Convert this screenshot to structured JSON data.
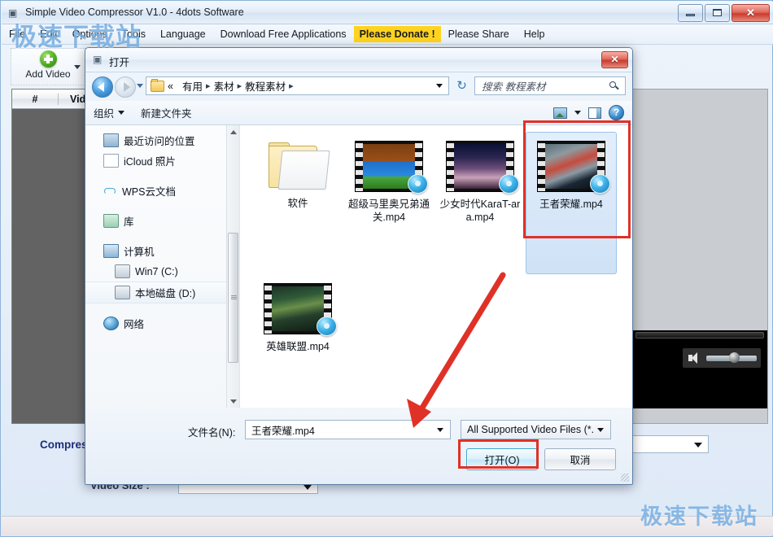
{
  "app": {
    "title": "Simple Video Compressor V1.0 - 4dots Software",
    "title_icon": "app-icon",
    "window_buttons": {
      "minimize": "",
      "maximize": "",
      "close": "✕"
    },
    "menu": [
      {
        "label": "File",
        "highlight": false
      },
      {
        "label": "Edit",
        "highlight": false
      },
      {
        "label": "Options",
        "highlight": false
      },
      {
        "label": "Tools",
        "highlight": false
      },
      {
        "label": "Language",
        "highlight": false
      },
      {
        "label": "Download Free Applications",
        "highlight": false
      },
      {
        "label": "Please Donate !",
        "highlight": true
      },
      {
        "label": "Please Share",
        "highlight": false
      },
      {
        "label": "Help",
        "highlight": false
      }
    ],
    "toolbar": {
      "add_video_label": "Add Video"
    },
    "table": {
      "columns": [
        "#",
        "Video"
      ]
    },
    "compress_label": "Compress",
    "video_size_label": "Video Size :"
  },
  "dialog": {
    "title": "打开",
    "title_icon": "folder-open-icon",
    "close_label": "✕",
    "breadcrumb": {
      "prefix": "«",
      "segments": [
        "有用",
        "素材",
        "教程素材"
      ],
      "separator": "▸"
    },
    "refresh_icon": "↻",
    "search": {
      "placeholder": "搜索 教程素材"
    },
    "toolbar": {
      "organize_label": "组织",
      "new_folder_label": "新建文件夹",
      "help_label": "?"
    },
    "nav_pane": [
      {
        "label": "最近访问的位置",
        "icon": "recent-places-icon",
        "type": "recent",
        "indent": false,
        "selected": false
      },
      {
        "label": "iCloud 照片",
        "icon": "document-icon",
        "type": "doc",
        "indent": false,
        "selected": false
      },
      {
        "label": "WPS云文档",
        "icon": "cloud-icon",
        "type": "cloud",
        "indent": false,
        "selected": false
      },
      {
        "label": "库",
        "icon": "library-icon",
        "type": "lib",
        "indent": false,
        "selected": false
      },
      {
        "label": "计算机",
        "icon": "computer-icon",
        "type": "pc",
        "indent": false,
        "selected": false
      },
      {
        "label": "Win7 (C:)",
        "icon": "hard-drive-icon",
        "type": "drive",
        "indent": true,
        "selected": false
      },
      {
        "label": "本地磁盘 (D:)",
        "icon": "hard-drive-icon",
        "type": "drive",
        "indent": true,
        "selected": true
      },
      {
        "label": "网络",
        "icon": "network-icon",
        "type": "net",
        "indent": false,
        "selected": false
      }
    ],
    "files": [
      {
        "name": "软件",
        "kind": "folder",
        "thumb": "",
        "selected": false
      },
      {
        "name": "超级马里奥兄弟通关.mp4",
        "kind": "video",
        "thumb": "img-mario",
        "selected": false
      },
      {
        "name": "少女时代KaraT-ara.mp4",
        "kind": "video",
        "thumb": "img-girls",
        "selected": false
      },
      {
        "name": "王者荣耀.mp4",
        "kind": "video",
        "thumb": "img-wz",
        "selected": true
      },
      {
        "name": "英雄联盟.mp4",
        "kind": "video",
        "thumb": "img-lol",
        "selected": false
      }
    ],
    "footer": {
      "filename_label": "文件名(N):",
      "filename_value": "王者荣耀.mp4",
      "filter_value": "All Supported Video Files (*.",
      "open_button": "打开(O)",
      "cancel_button": "取消"
    }
  },
  "watermark": {
    "text": "极速下载站"
  },
  "colors": {
    "donate_highlight": "#ffd320",
    "annotation_red": "#e03127",
    "accent_blue": "#1f2d7a",
    "selection_blue": "#cfe2f6"
  }
}
